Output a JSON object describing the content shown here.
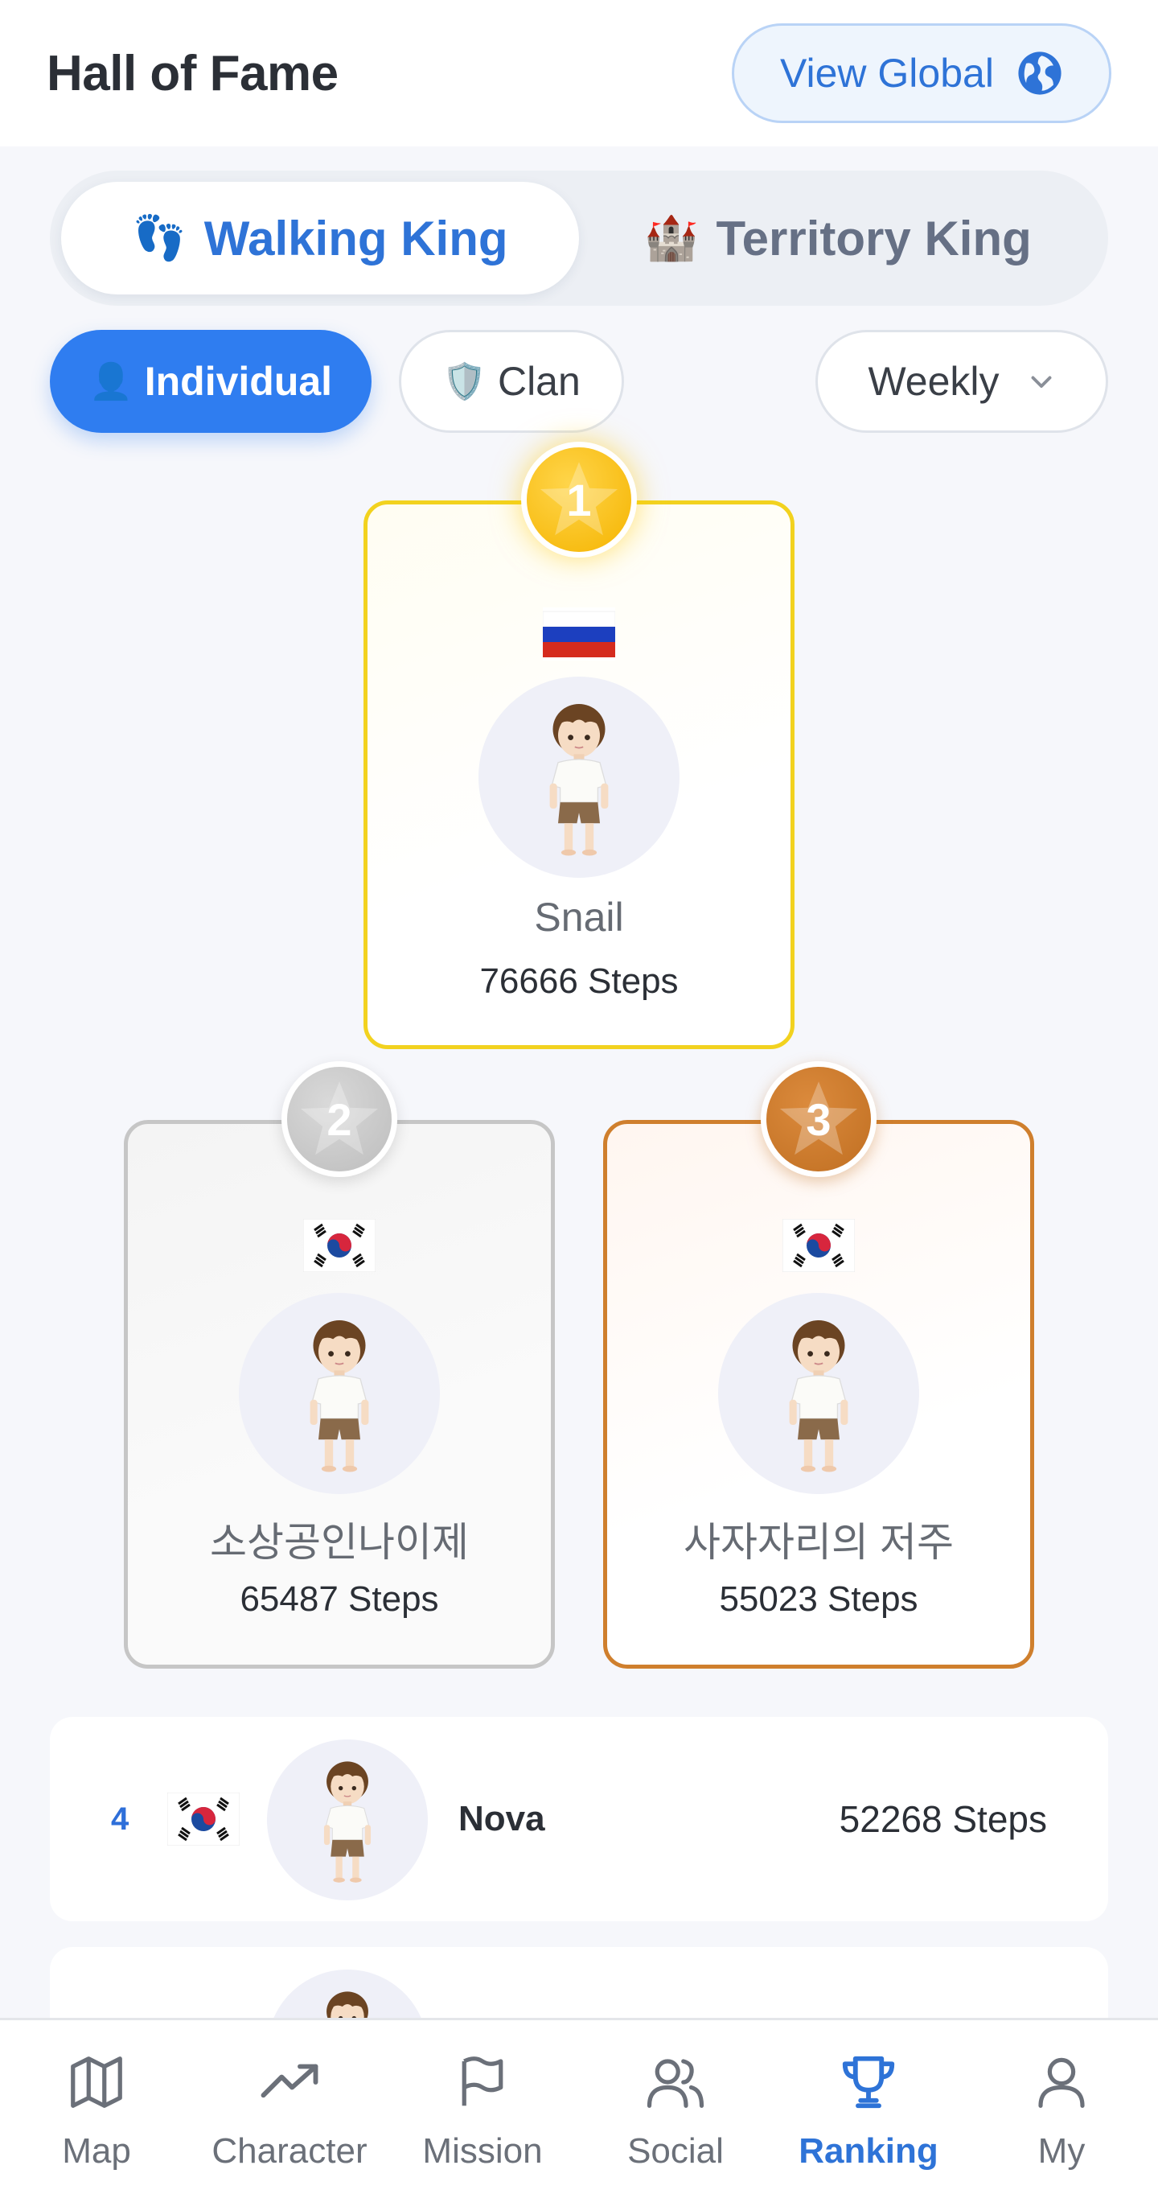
{
  "header": {
    "title": "Hall of Fame",
    "view_global_label": "View Global"
  },
  "category_tabs": [
    {
      "label": "Walking King",
      "icon": "footprints-icon",
      "emoji": "👣",
      "active": true
    },
    {
      "label": "Territory King",
      "icon": "castle-icon",
      "emoji": "🏰",
      "active": false
    }
  ],
  "filters": {
    "individual_label": "Individual",
    "individual_emoji": "👤",
    "clan_label": "Clan",
    "clan_emoji": "🛡️",
    "period": "Weekly",
    "active": "Individual"
  },
  "podium": [
    {
      "rank": "1",
      "name": "Snail",
      "steps": "76666 Steps",
      "country": "Russia"
    },
    {
      "rank": "2",
      "name": "소상공인나이제",
      "steps": "65487 Steps",
      "country": "South Korea"
    },
    {
      "rank": "3",
      "name": "사자자리의 저주",
      "steps": "55023 Steps",
      "country": "South Korea"
    }
  ],
  "list": [
    {
      "rank": "4",
      "name": "Nova",
      "steps": "52268 Steps",
      "country": "South Korea"
    }
  ],
  "bottom_nav": [
    {
      "label": "Map",
      "icon": "map-icon",
      "active": false
    },
    {
      "label": "Character",
      "icon": "trending-up-icon",
      "active": false
    },
    {
      "label": "Mission",
      "icon": "flag-icon",
      "active": false
    },
    {
      "label": "Social",
      "icon": "users-icon",
      "active": false
    },
    {
      "label": "Ranking",
      "icon": "trophy-icon",
      "active": true
    },
    {
      "label": "My",
      "icon": "user-icon",
      "active": false
    }
  ],
  "colors": {
    "accent": "#2f7df0",
    "gold": "#f2d21f",
    "silver": "#c6c6c6",
    "bronze": "#cf7f2d"
  }
}
